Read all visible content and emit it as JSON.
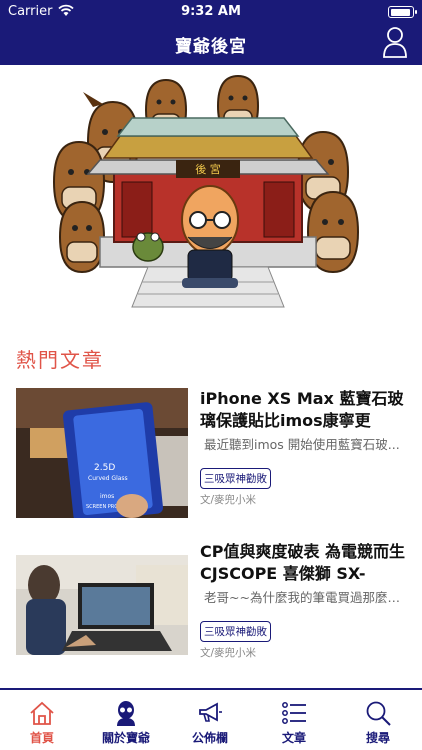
{
  "status_bar": {
    "carrier": "Carrier",
    "time": "9:32 AM"
  },
  "nav": {
    "title": "寶爺後宮"
  },
  "hero": {
    "sign_text": "後 宮"
  },
  "section": {
    "title": "熱門文章"
  },
  "articles": [
    {
      "title": "iPhone XS Max 藍寶石玻璃保護貼比imos康寧更",
      "excerpt": "最近聽到imos 開始使用藍寶石玻...",
      "tag": "三吸眾神勸敗",
      "author": "文/麥兜小米",
      "thumb_text": [
        "2.5D",
        "Curved Glass",
        "imos",
        "SCREEN PROTECTOR"
      ]
    },
    {
      "title": "CP值與爽度破表 為電競而生 CJSCOPE 喜傑獅 SX-",
      "excerpt": "老哥~~為什麼我的筆電買過那麼多...",
      "tag": "三吸眾神勸敗",
      "author": "文/麥兜小米"
    }
  ],
  "tabs": [
    {
      "label": "首頁",
      "icon": "home-icon",
      "active": true
    },
    {
      "label": "關於寶爺",
      "icon": "portrait-icon",
      "active": false
    },
    {
      "label": "公佈欄",
      "icon": "megaphone-icon",
      "active": false
    },
    {
      "label": "文章",
      "icon": "list-icon",
      "active": false
    },
    {
      "label": "搜尋",
      "icon": "search-icon",
      "active": false
    }
  ],
  "colors": {
    "nav_bg": "#1a1a78",
    "accent": "#e05448"
  }
}
